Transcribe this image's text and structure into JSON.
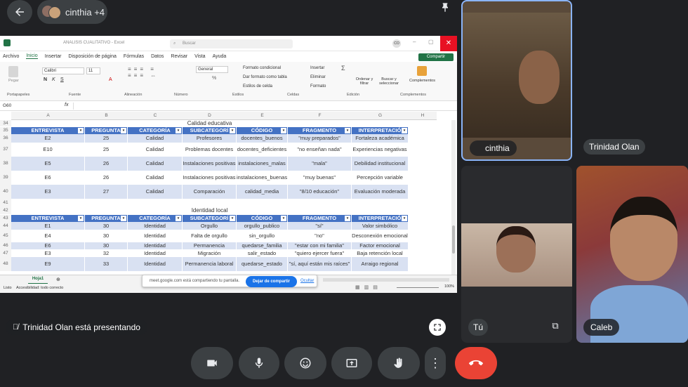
{
  "meeting": {
    "participants_chip": "cinthia +4",
    "presenting_text": "Trinidad Olan está presentando"
  },
  "tiles": {
    "t1": "cinthia",
    "t2": "Trinidad Olan",
    "t3": "Tú",
    "t4": "Caleb"
  },
  "excel": {
    "title": "ANALISIS CUALITATIVO - Excel",
    "search_placeholder": "Buscar",
    "user_initials": "CO",
    "share_label": "Compartir",
    "menus": [
      "Archivo",
      "Inicio",
      "Insertar",
      "Disposición de página",
      "Fórmulas",
      "Datos",
      "Revisar",
      "Vista",
      "Ayuda"
    ],
    "ribbon_groups": [
      "Portapapeles",
      "Fuente",
      "Alineación",
      "Número",
      "Estilos",
      "Celdas",
      "Edición",
      "Complementos"
    ],
    "ribbon": {
      "paste": "Pegar",
      "font": "Calibri",
      "size": "11",
      "number_format": "General",
      "style1": "Formato condicional",
      "style2": "Dar formato como tabla",
      "style3": "Estilos de celda",
      "insert": "Insertar",
      "delete": "Eliminar",
      "format": "Formato",
      "sort": "Ordenar y filtrar",
      "find": "Buscar y seleccionar",
      "addins": "Complementos"
    },
    "cell_ref": "G60",
    "columns": [
      "A",
      "B",
      "C",
      "D",
      "E",
      "F",
      "G",
      "H"
    ],
    "rows": {
      "r34": "34",
      "r35": "35",
      "r36": "36",
      "r37": "37",
      "r38": "38",
      "r39": "39",
      "r40": "40",
      "r41": "41",
      "r42": "42",
      "r43": "43",
      "r44": "44",
      "r45": "45",
      "r46": "46",
      "r47": "47",
      "r48": "48"
    },
    "headers": [
      "ENTREVISTA",
      "PREGUNTA",
      "CATEGORÍA",
      "SUBCATEGORÍ",
      "CÓDIGO",
      "FRAGMENTO",
      "INTERPRETACIÓ"
    ],
    "section1_title": "Calidad educativa",
    "section1": [
      [
        "E2",
        "25",
        "Calidad",
        "Profesores",
        "docentes_buenos",
        "\"muy preparados\"",
        "Fortaleza académica"
      ],
      [
        "E10",
        "25",
        "Calidad",
        "Problemas docentes",
        "docentes_deficientes",
        "\"no enseñan nada\"",
        "Experiencias negativas"
      ],
      [
        "E5",
        "26",
        "Calidad",
        "Instalaciones positivas",
        "instalaciones_malas",
        "\"mala\"",
        "Debilidad institucional"
      ],
      [
        "E6",
        "26",
        "Calidad",
        "Instalaciones positivas",
        "instalaciones_buenas",
        "\"muy buenas\"",
        "Percepción variable"
      ],
      [
        "E3",
        "27",
        "Calidad",
        "Comparación",
        "calidad_media",
        "\"8/10 educación\"",
        "Evaluación moderada"
      ]
    ],
    "section2_title": "Identidad local",
    "section2": [
      [
        "E1",
        "30",
        "Identidad",
        "Orgullo",
        "orgullo_publico",
        "\"sí\"",
        "Valor simbólico"
      ],
      [
        "E4",
        "30",
        "Identidad",
        "Falta de orgullo",
        "sin_orgullo",
        "\"no\"",
        "Desconexión emocional"
      ],
      [
        "E6",
        "30",
        "Identidad",
        "Permanencia",
        "quedarse_familia",
        "\"estar con mi familia\"",
        "Factor emocional"
      ],
      [
        "E3",
        "32",
        "Identidad",
        "Migración",
        "salir_estado",
        "\"quiero ejercer fuera\"",
        "Baja retención local"
      ],
      [
        "E9",
        "33",
        "Identidad",
        "Permanencia laboral",
        "quedarse_estado",
        "\"sí, aquí están mis raíces\"",
        "Arraigo regional"
      ]
    ],
    "sheet_tab": "Hoja1",
    "status_ready": "Listo",
    "status_access": "Accesibilidad: todo correcto",
    "zoom": "100%"
  },
  "share_banner": {
    "text": "meet.google.com está compartiendo tu pantalla.",
    "stop": "Dejar de compartir",
    "hide": "Ocultar"
  },
  "colors": {
    "header_blue": "#4472c4",
    "band": "#d9e1f2",
    "end_call": "#ea4335",
    "excel_green": "#217346"
  }
}
